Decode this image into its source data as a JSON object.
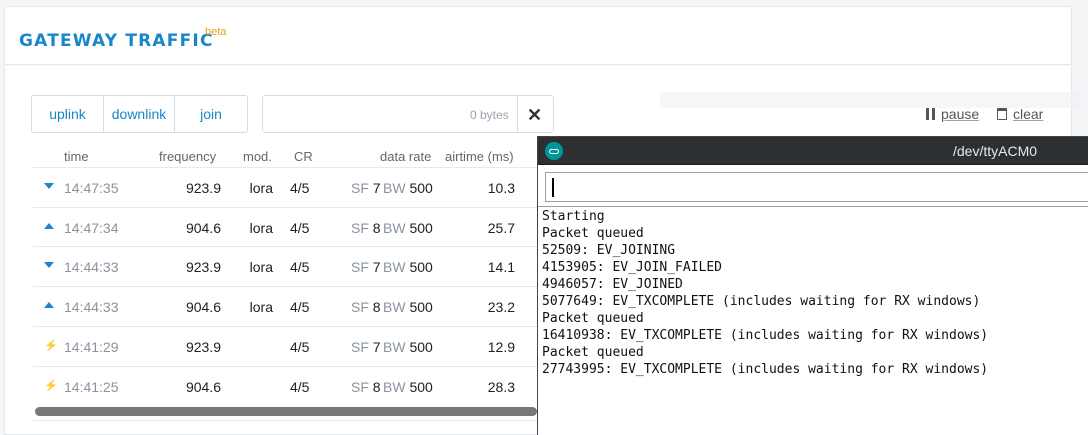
{
  "header": {
    "title": "GATEWAY TRAFFIC",
    "badge": "beta"
  },
  "filters": [
    {
      "label": "uplink"
    },
    {
      "label": "downlink"
    },
    {
      "label": "join"
    }
  ],
  "search": {
    "value": "",
    "bytes_label": "0 bytes",
    "clear_glyph": "✕"
  },
  "controls": {
    "pause_label": "pause",
    "clear_label": "clear"
  },
  "table": {
    "columns": [
      "time",
      "frequency",
      "mod.",
      "CR",
      "data rate",
      "airtime (ms)"
    ],
    "sf_label": "SF",
    "bw_label": "BW",
    "rows": [
      {
        "dir": "downlink",
        "time": "14:47:35",
        "frequency": "923.9",
        "mod": "lora",
        "cr": "4/5",
        "sf": "7",
        "bw": "500",
        "airtime": "10.3"
      },
      {
        "dir": "uplink",
        "time": "14:47:34",
        "frequency": "904.6",
        "mod": "lora",
        "cr": "4/5",
        "sf": "8",
        "bw": "500",
        "airtime": "25.7"
      },
      {
        "dir": "downlink",
        "time": "14:44:33",
        "frequency": "923.9",
        "mod": "lora",
        "cr": "4/5",
        "sf": "7",
        "bw": "500",
        "airtime": "14.1"
      },
      {
        "dir": "uplink",
        "time": "14:44:33",
        "frequency": "904.6",
        "mod": "lora",
        "cr": "4/5",
        "sf": "8",
        "bw": "500",
        "airtime": "23.2"
      },
      {
        "dir": "join-accept",
        "time": "14:41:29",
        "frequency": "923.9",
        "mod": "",
        "cr": "4/5",
        "sf": "7",
        "bw": "500",
        "airtime": "12.9"
      },
      {
        "dir": "join-request",
        "time": "14:41:25",
        "frequency": "904.6",
        "mod": "",
        "cr": "4/5",
        "sf": "8",
        "bw": "500",
        "airtime": "28.3"
      }
    ]
  },
  "serial_monitor": {
    "title": "/dev/ttyACM0",
    "input_value": "",
    "output_lines": [
      "Starting",
      "Packet queued",
      "52509: EV_JOINING",
      "4153905: EV_JOIN_FAILED",
      "4946057: EV_JOINED",
      "5077649: EV_TXCOMPLETE (includes waiting for RX windows)",
      "Packet queued",
      "16410938: EV_TXCOMPLETE (includes waiting for RX windows)",
      "Packet queued",
      "27743995: EV_TXCOMPLETE (includes waiting for RX windows)"
    ]
  },
  "colors": {
    "accent": "#1a86c8",
    "beta": "#e3a21a",
    "join_accept": "#4caf50",
    "join_request": "#f1b21b",
    "arduino": "#00979c"
  },
  "icons": {
    "downlink": "triangle-down-icon",
    "uplink": "triangle-up-icon",
    "join-accept": "bolt-icon",
    "join-request": "bolt-icon",
    "pause": "pause-icon",
    "clear": "trash-icon",
    "serial": "arduino-icon"
  }
}
